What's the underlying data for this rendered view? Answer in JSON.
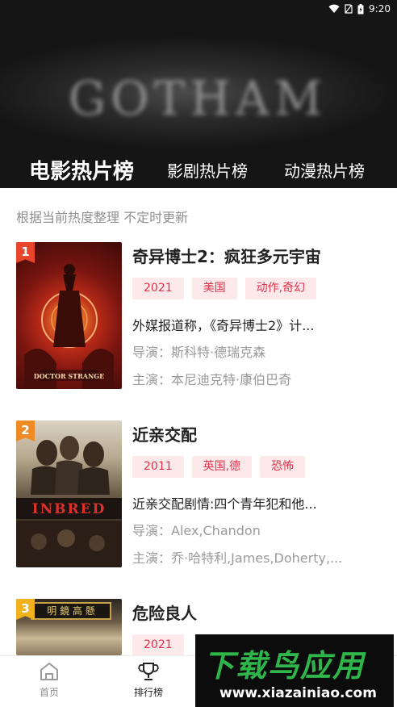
{
  "status_bar": {
    "time": "9:20"
  },
  "banner": {
    "title": "GOTHAM"
  },
  "tabs": [
    {
      "label": "电影热片榜",
      "active": true
    },
    {
      "label": "影剧热片榜",
      "active": false
    },
    {
      "label": "动漫热片榜",
      "active": false
    }
  ],
  "subtitle": "根据当前热度整理 不定时更新",
  "movies": [
    {
      "rank": "1",
      "title": "奇异博士2：疯狂多元宇宙",
      "tags": [
        "2021",
        "美国",
        "动作,奇幻"
      ],
      "description": "外媒报道称，《奇异博士2》计...",
      "director": "导演：斯科特·德瑞克森",
      "actors": "主演：本尼迪克特·康伯巴奇",
      "poster_text": "DOCTOR STRANGE"
    },
    {
      "rank": "2",
      "title": "近亲交配",
      "tags": [
        "2011",
        "英国,德",
        "恐怖"
      ],
      "description": "近亲交配剧情:四个青年犯和他...",
      "director": "导演：Alex,Chandon",
      "actors": "主演：乔·哈特利,James,Doherty,...",
      "poster_text": "INBRED"
    },
    {
      "rank": "3",
      "title": "危险良人",
      "tags": [
        "2021"
      ],
      "poster_text": "明 鏡 高 懸"
    }
  ],
  "bottom_nav": [
    {
      "label": "首页",
      "icon": "home-icon",
      "active": false
    },
    {
      "label": "排行榜",
      "icon": "trophy-icon",
      "active": true
    }
  ],
  "watermark": {
    "title": "下载鸟应用",
    "url": "www.xiazainiao.com"
  },
  "colors": {
    "tag_bg": "#fde8ea",
    "tag_text": "#e0334b",
    "rank1": "#e8452c",
    "rank2": "#f08a24",
    "rank3": "#f2b21d",
    "watermark_green": "#2fb54a"
  }
}
